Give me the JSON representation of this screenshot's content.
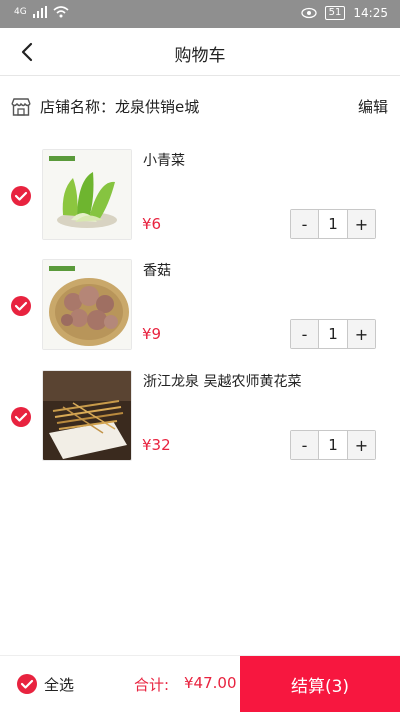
{
  "status_bar": {
    "network": "4G",
    "time": "14:25",
    "battery": "51"
  },
  "header": {
    "title": "购物车",
    "back_icon": "back-arrow-icon"
  },
  "shop": {
    "name": "店铺名称：龙泉供销e城",
    "edit_label": "编辑",
    "icon": "store-icon"
  },
  "items": [
    {
      "name": "小青菜",
      "price": "¥6",
      "quantity": "1",
      "minus": "-",
      "plus": "+",
      "checked": true
    },
    {
      "name": "香菇",
      "price": "¥9",
      "quantity": "1",
      "minus": "-",
      "plus": "+",
      "checked": true
    },
    {
      "name": "浙江龙泉 吴越农师黄花菜",
      "price": "¥32",
      "quantity": "1",
      "minus": "-",
      "plus": "+",
      "checked": true
    }
  ],
  "footer": {
    "select_all_label": "全选",
    "total_label": "合计:",
    "total_value": "¥47.00",
    "checkout_label": "结算(3)"
  },
  "colors": {
    "accent": "#f7173f",
    "price": "#e8233f",
    "statusbar": "#8f8f8f"
  }
}
